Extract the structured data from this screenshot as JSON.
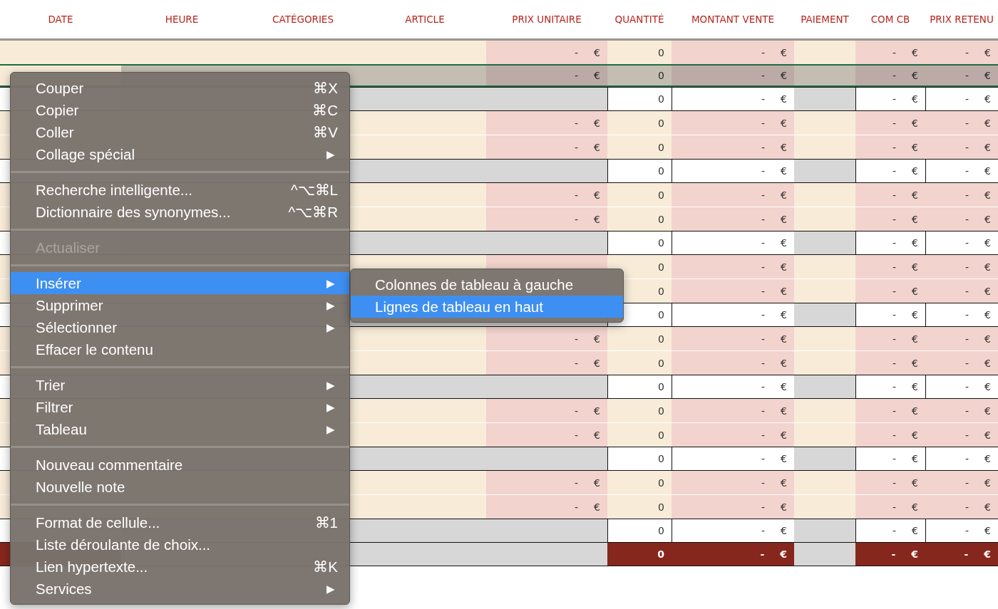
{
  "columns": [
    "DATE",
    "HEURE",
    "CATÉGORIES",
    "ARTICLE",
    "PRIX UNITAIRE",
    "QUANTITÉ",
    "MONTANT VENTE",
    "PAIEMENT",
    "COM CB",
    "PRIX RETENU"
  ],
  "rows": [
    {
      "kind": "detail",
      "selected": false,
      "prix_unitaire": [
        "-",
        "€"
      ],
      "quantite": "0",
      "montant_vente": [
        "-",
        "€"
      ],
      "com_cb": [
        "-",
        "€"
      ],
      "prix_retenu": [
        "-",
        "€"
      ]
    },
    {
      "kind": "detail",
      "selected": true,
      "prix_unitaire": [
        "-",
        "€"
      ],
      "quantite": "0",
      "montant_vente": [
        "-",
        "€"
      ],
      "com_cb": [
        "-",
        "€"
      ],
      "prix_retenu": [
        "-",
        "€"
      ]
    },
    {
      "kind": "subtotal",
      "selected": false,
      "quantite": "0",
      "montant_vente": [
        "-",
        "€"
      ],
      "com_cb": [
        "-",
        "€"
      ],
      "prix_retenu": [
        "-",
        "€"
      ]
    },
    {
      "kind": "detail",
      "selected": false,
      "prix_unitaire": [
        "-",
        "€"
      ],
      "quantite": "0",
      "montant_vente": [
        "-",
        "€"
      ],
      "com_cb": [
        "-",
        "€"
      ],
      "prix_retenu": [
        "-",
        "€"
      ]
    },
    {
      "kind": "detail",
      "selected": false,
      "prix_unitaire": [
        "-",
        "€"
      ],
      "quantite": "0",
      "montant_vente": [
        "-",
        "€"
      ],
      "com_cb": [
        "-",
        "€"
      ],
      "prix_retenu": [
        "-",
        "€"
      ]
    },
    {
      "kind": "subtotal",
      "selected": false,
      "quantite": "0",
      "montant_vente": [
        "-",
        "€"
      ],
      "com_cb": [
        "-",
        "€"
      ],
      "prix_retenu": [
        "-",
        "€"
      ]
    },
    {
      "kind": "detail",
      "selected": false,
      "prix_unitaire": [
        "-",
        "€"
      ],
      "quantite": "0",
      "montant_vente": [
        "-",
        "€"
      ],
      "com_cb": [
        "-",
        "€"
      ],
      "prix_retenu": [
        "-",
        "€"
      ]
    },
    {
      "kind": "detail",
      "selected": false,
      "prix_unitaire": [
        "-",
        "€"
      ],
      "quantite": "0",
      "montant_vente": [
        "-",
        "€"
      ],
      "com_cb": [
        "-",
        "€"
      ],
      "prix_retenu": [
        "-",
        "€"
      ]
    },
    {
      "kind": "subtotal",
      "selected": false,
      "quantite": "0",
      "montant_vente": [
        "-",
        "€"
      ],
      "com_cb": [
        "-",
        "€"
      ],
      "prix_retenu": [
        "-",
        "€"
      ]
    },
    {
      "kind": "detail",
      "selected": false,
      "quantite": "0",
      "montant_vente": [
        "-",
        "€"
      ],
      "com_cb": [
        "-",
        "€"
      ],
      "prix_retenu": [
        "-",
        "€"
      ]
    },
    {
      "kind": "detail",
      "selected": false,
      "quantite": "0",
      "montant_vente": [
        "-",
        "€"
      ],
      "com_cb": [
        "-",
        "€"
      ],
      "prix_retenu": [
        "-",
        "€"
      ]
    },
    {
      "kind": "subtotal",
      "selected": false,
      "quantite": "0",
      "montant_vente": [
        "-",
        "€"
      ],
      "com_cb": [
        "-",
        "€"
      ],
      "prix_retenu": [
        "-",
        "€"
      ]
    },
    {
      "kind": "detail",
      "selected": false,
      "prix_unitaire": [
        "-",
        "€"
      ],
      "quantite": "0",
      "montant_vente": [
        "-",
        "€"
      ],
      "com_cb": [
        "-",
        "€"
      ],
      "prix_retenu": [
        "-",
        "€"
      ]
    },
    {
      "kind": "detail",
      "selected": false,
      "prix_unitaire": [
        "-",
        "€"
      ],
      "quantite": "0",
      "montant_vente": [
        "-",
        "€"
      ],
      "com_cb": [
        "-",
        "€"
      ],
      "prix_retenu": [
        "-",
        "€"
      ]
    },
    {
      "kind": "subtotal",
      "selected": false,
      "quantite": "0",
      "montant_vente": [
        "-",
        "€"
      ],
      "com_cb": [
        "-",
        "€"
      ],
      "prix_retenu": [
        "-",
        "€"
      ]
    },
    {
      "kind": "detail",
      "selected": false,
      "prix_unitaire": [
        "-",
        "€"
      ],
      "quantite": "0",
      "montant_vente": [
        "-",
        "€"
      ],
      "com_cb": [
        "-",
        "€"
      ],
      "prix_retenu": [
        "-",
        "€"
      ]
    },
    {
      "kind": "detail",
      "selected": false,
      "prix_unitaire": [
        "-",
        "€"
      ],
      "quantite": "0",
      "montant_vente": [
        "-",
        "€"
      ],
      "com_cb": [
        "-",
        "€"
      ],
      "prix_retenu": [
        "-",
        "€"
      ]
    },
    {
      "kind": "subtotal",
      "selected": false,
      "quantite": "0",
      "montant_vente": [
        "-",
        "€"
      ],
      "com_cb": [
        "-",
        "€"
      ],
      "prix_retenu": [
        "-",
        "€"
      ]
    },
    {
      "kind": "detail",
      "selected": false,
      "prix_unitaire": [
        "-",
        "€"
      ],
      "quantite": "0",
      "montant_vente": [
        "-",
        "€"
      ],
      "com_cb": [
        "-",
        "€"
      ],
      "prix_retenu": [
        "-",
        "€"
      ]
    },
    {
      "kind": "detail",
      "selected": false,
      "prix_unitaire": [
        "-",
        "€"
      ],
      "quantite": "0",
      "montant_vente": [
        "-",
        "€"
      ],
      "com_cb": [
        "-",
        "€"
      ],
      "prix_retenu": [
        "-",
        "€"
      ]
    },
    {
      "kind": "subtotal",
      "selected": false,
      "quantite": "0",
      "montant_vente": [
        "-",
        "€"
      ],
      "com_cb": [
        "-",
        "€"
      ],
      "prix_retenu": [
        "-",
        "€"
      ]
    },
    {
      "kind": "total",
      "selected": false,
      "quantite": "0",
      "montant_vente": [
        "-",
        "€"
      ],
      "com_cb": [
        "-",
        "€"
      ],
      "prix_retenu": [
        "-",
        "€"
      ]
    }
  ],
  "context_menu": {
    "sections": [
      [
        {
          "label": "Couper",
          "shortcut": "⌘X",
          "selected": false,
          "disabled": false
        },
        {
          "label": "Copier",
          "shortcut": "⌘C",
          "selected": false,
          "disabled": false
        },
        {
          "label": "Coller",
          "shortcut": "⌘V",
          "selected": false,
          "disabled": false
        },
        {
          "label": "Collage spécial",
          "arrow": "▶",
          "selected": false,
          "disabled": false
        }
      ],
      [
        {
          "label": "Recherche intelligente...",
          "shortcut": "^⌥⌘L",
          "selected": false,
          "disabled": false
        },
        {
          "label": "Dictionnaire des synonymes...",
          "shortcut": "^⌥⌘R",
          "selected": false,
          "disabled": false
        }
      ],
      [
        {
          "label": "Actualiser",
          "selected": false,
          "disabled": true
        }
      ],
      [
        {
          "label": "Insérer",
          "arrow": "▶",
          "selected": true,
          "disabled": false
        },
        {
          "label": "Supprimer",
          "arrow": "▶",
          "selected": false,
          "disabled": false
        },
        {
          "label": "Sélectionner",
          "arrow": "▶",
          "selected": false,
          "disabled": false
        },
        {
          "label": "Effacer le contenu",
          "selected": false,
          "disabled": false
        }
      ],
      [
        {
          "label": "Trier",
          "arrow": "▶",
          "selected": false,
          "disabled": false
        },
        {
          "label": "Filtrer",
          "arrow": "▶",
          "selected": false,
          "disabled": false
        },
        {
          "label": "Tableau",
          "arrow": "▶",
          "selected": false,
          "disabled": false
        }
      ],
      [
        {
          "label": "Nouveau commentaire",
          "selected": false,
          "disabled": false
        },
        {
          "label": "Nouvelle note",
          "selected": false,
          "disabled": false
        }
      ],
      [
        {
          "label": "Format de cellule...",
          "shortcut": "⌘1",
          "selected": false,
          "disabled": false
        },
        {
          "label": "Liste déroulante de choix...",
          "selected": false,
          "disabled": false
        },
        {
          "label": "Lien hypertexte...",
          "shortcut": "⌘K",
          "selected": false,
          "disabled": false
        },
        {
          "label": "Services",
          "arrow": "▶",
          "selected": false,
          "disabled": false
        }
      ]
    ]
  },
  "submenu": {
    "items": [
      {
        "label": "Colonnes de tableau à gauche",
        "selected": false
      },
      {
        "label": "Lignes de tableau en haut",
        "selected": true
      }
    ]
  }
}
